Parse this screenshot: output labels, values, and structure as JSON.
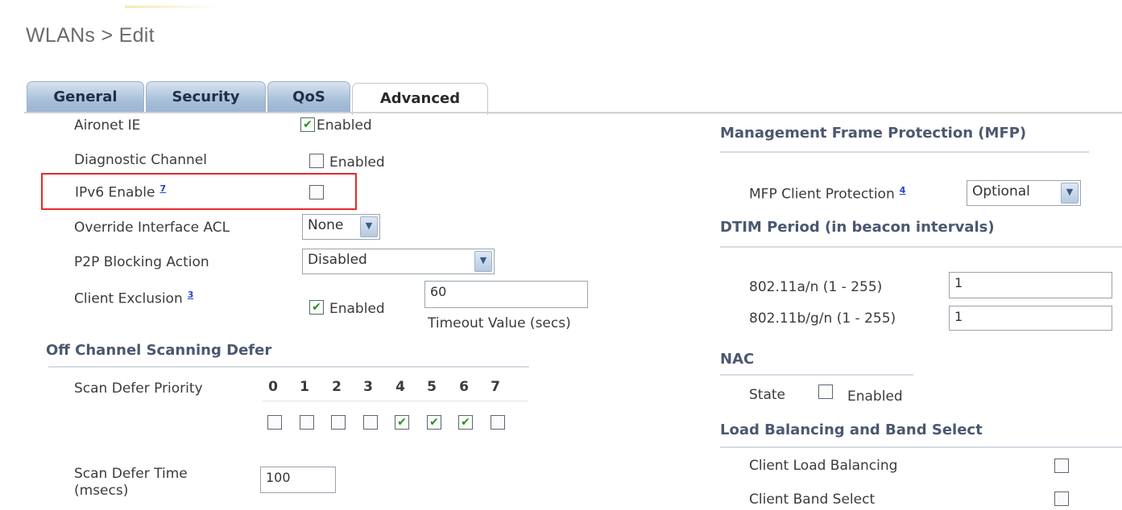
{
  "page": {
    "title": "WLANs > Edit"
  },
  "tabs": [
    {
      "label": "General"
    },
    {
      "label": "Security"
    },
    {
      "label": "QoS"
    },
    {
      "label": "Advanced"
    }
  ],
  "left": {
    "aironet_ie": {
      "label": "Aironet IE",
      "option": "Enabled",
      "checked": true
    },
    "diagnostic_channel": {
      "label": "Diagnostic Channel",
      "option": "Enabled",
      "checked": false
    },
    "ipv6_enable": {
      "label": "IPv6 Enable",
      "footnote": "7",
      "checked": false
    },
    "override_acl": {
      "label": "Override Interface ACL",
      "value": "None"
    },
    "p2p_blocking": {
      "label": "P2P Blocking Action",
      "value": "Disabled"
    },
    "client_exclusion": {
      "label": "Client Exclusion",
      "footnote": "3",
      "option": "Enabled",
      "checked": true,
      "timeout_value": "60",
      "timeout_caption": "Timeout Value (secs)"
    },
    "off_channel": {
      "title": "Off Channel Scanning Defer",
      "priority_label": "Scan Defer Priority",
      "priorities": [
        "0",
        "1",
        "2",
        "3",
        "4",
        "5",
        "6",
        "7"
      ],
      "priority_checked": [
        false,
        false,
        false,
        false,
        true,
        true,
        true,
        false
      ],
      "time_label_line1": "Scan Defer Time",
      "time_label_line2": "(msecs)",
      "time_value": "100"
    }
  },
  "right": {
    "mfp": {
      "title": "Management Frame Protection (MFP)",
      "label": "MFP Client Protection",
      "footnote": "4",
      "value": "Optional"
    },
    "dtim": {
      "title": "DTIM Period (in beacon intervals)",
      "a_label": "802.11a/n (1 - 255)",
      "a_value": "1",
      "bg_label": "802.11b/g/n (1 - 255)",
      "bg_value": "1"
    },
    "nac": {
      "title": "NAC",
      "state_label": "State",
      "option": "Enabled",
      "checked": false
    },
    "load_balancing": {
      "title": "Load Balancing and Band Select",
      "client_lb_label": "Client Load Balancing",
      "client_lb_checked": false,
      "band_select_label": "Client Band Select",
      "band_select_checked": false
    }
  },
  "icons": {
    "checkmark": "check-icon",
    "dropdown": "chevron-down-icon"
  },
  "colors": {
    "highlight": "#e8282c",
    "tab_blue": "#a9c0da",
    "section_text": "#4b5870",
    "footnote_link": "#2244cc"
  }
}
